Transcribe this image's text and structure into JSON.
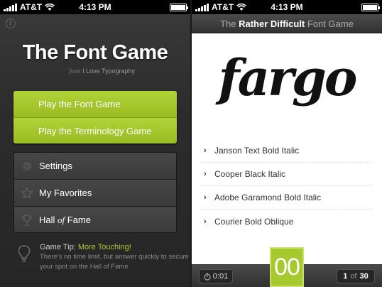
{
  "status": {
    "carrier": "AT&T",
    "time": "4:13 PM"
  },
  "left": {
    "info_glyph": "i",
    "title": "The Font Game",
    "from": "from",
    "by": "I Love Typography",
    "primary_buttons": [
      "Play the Font Game",
      "Play the Terminology Game"
    ],
    "secondary_buttons": [
      {
        "label": "Settings",
        "rest": "",
        "icon": "gear-icon"
      },
      {
        "label": "My Favorites",
        "rest": "",
        "icon": "star-icon"
      },
      {
        "label": "Hall ",
        "rest": "of",
        "label2": " Fame",
        "icon": "trophy-icon"
      }
    ],
    "tip": {
      "title_prefix": "Game Tip:",
      "title_highlight": "More Touching!",
      "body": "There's no time limit, but answer quickly to secure your spot on the Hall of Fame"
    }
  },
  "right": {
    "header_pre": "The",
    "header_strong": "Rather Difficult",
    "header_post": "Font Game",
    "specimen": "fargo",
    "options": [
      "Janson Text Bold Italic",
      "Cooper Black Italic",
      "Adobe Garamond Bold Italic",
      "Courier Bold Oblique"
    ],
    "timer": "0:01",
    "score": "00",
    "question_current": "1",
    "question_of": "of",
    "question_total": "30"
  },
  "colors": {
    "accent_green": "#a5c92e",
    "dark_bg": "#2c2c2c"
  }
}
